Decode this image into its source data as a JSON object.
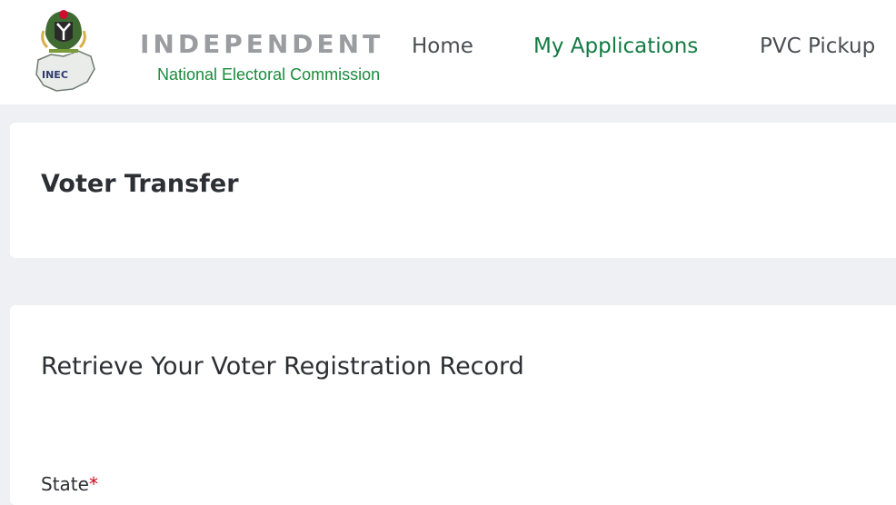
{
  "brand": {
    "name": "INDEPENDENT",
    "subtitle": "National Electoral Commission",
    "emblem_text": "INEC",
    "colors": {
      "green": "#1a8c3c",
      "grey": "#9b9c9f"
    }
  },
  "nav": {
    "items": [
      {
        "label": "Home",
        "active": false
      },
      {
        "label": "My Applications",
        "active": true
      },
      {
        "label": "PVC Pickup",
        "active": false
      }
    ],
    "active_color": "#137a43"
  },
  "page": {
    "title": "Voter Transfer"
  },
  "form": {
    "section_title": "Retrieve Your Voter Registration Record",
    "state_label": "State",
    "required_mark": "*"
  }
}
